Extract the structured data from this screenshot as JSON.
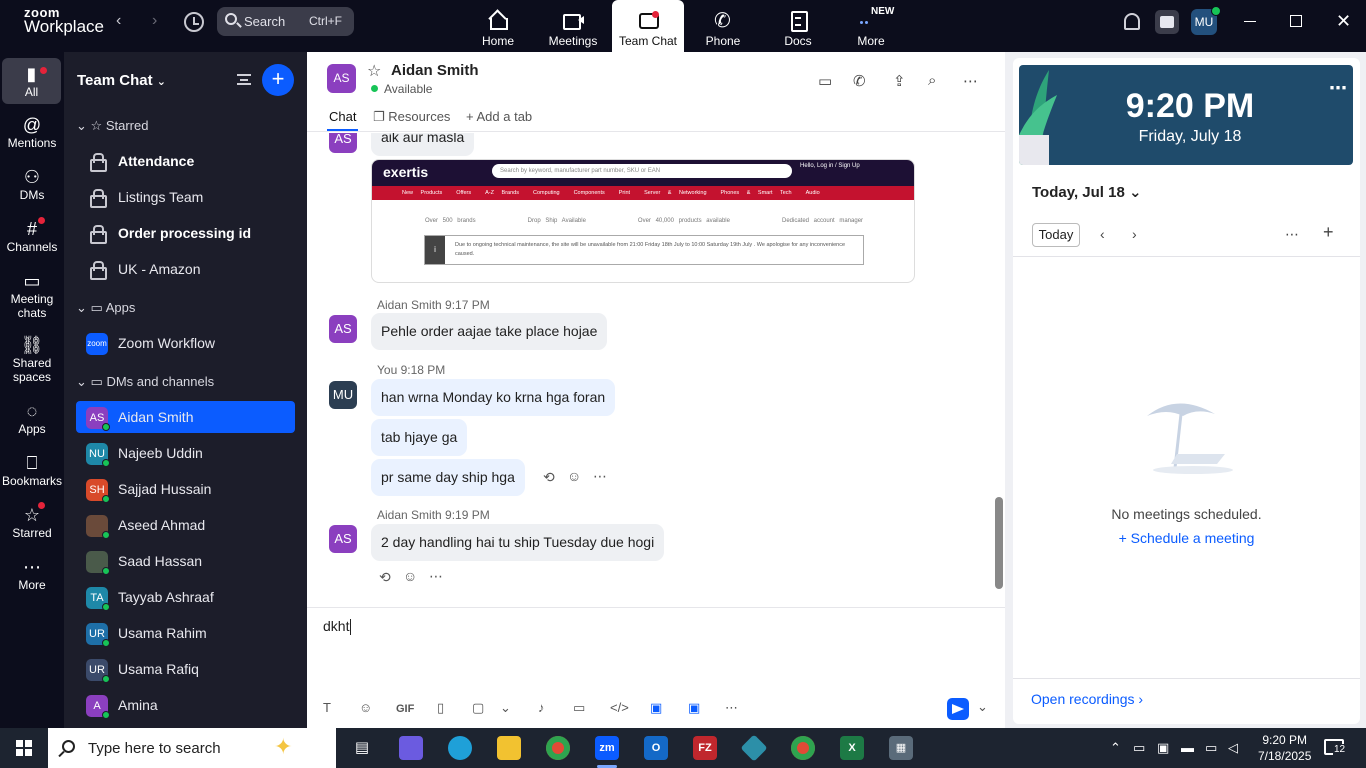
{
  "topbar": {
    "logo_top": "zoom",
    "logo_bottom": "Workplace",
    "search_label": "Search",
    "search_shortcut": "Ctrl+F",
    "tabs": [
      {
        "label": "Home",
        "icon": "home-icon"
      },
      {
        "label": "Meetings",
        "icon": "video-camera-icon"
      },
      {
        "label": "Team Chat",
        "icon": "chat-icon"
      },
      {
        "label": "Phone",
        "icon": "phone-icon"
      },
      {
        "label": "Docs",
        "icon": "document-icon"
      },
      {
        "label": "More",
        "icon": "more-dots-icon"
      }
    ],
    "new_badge": "NEW",
    "user_initials": "MU"
  },
  "leftnav": [
    {
      "label": "All",
      "icon": "chat-bubble-icon"
    },
    {
      "label": "Mentions",
      "icon": "at-icon"
    },
    {
      "label": "DMs",
      "icon": "people-icon"
    },
    {
      "label": "Channels",
      "icon": "hash-icon"
    },
    {
      "label": "Meeting chats",
      "icon": "calendar-chat-icon"
    },
    {
      "label": "Shared spaces",
      "icon": "shared-spaces-icon"
    },
    {
      "label": "Apps",
      "icon": "apps-icon"
    },
    {
      "label": "Bookmarks",
      "icon": "bookmark-icon"
    },
    {
      "label": "Starred",
      "icon": "star-icon"
    },
    {
      "label": "More",
      "icon": "more-dots-icon"
    }
  ],
  "panel": {
    "title": "Team Chat",
    "sections": {
      "starred": "Starred",
      "apps": "Apps",
      "dms": "DMs and channels"
    },
    "starred_items": [
      "Attendance",
      "Listings Team",
      "Order processing id",
      "UK - Amazon"
    ],
    "apps_items": [
      {
        "name": "Zoom Workflow",
        "badge": "zoom"
      }
    ],
    "dm_items": [
      {
        "initials": "AS",
        "name": "Aidan Smith",
        "color": "#8b3fbf"
      },
      {
        "initials": "NU",
        "name": "Najeeb Uddin",
        "color": "#1e88a8"
      },
      {
        "initials": "SH",
        "name": "Sajjad Hussain",
        "color": "#d84a2a"
      },
      {
        "initials": "",
        "name": "Aseed Ahmad",
        "color": "#6a4a3a"
      },
      {
        "initials": "",
        "name": "Saad Hassan",
        "color": "#4a5a4a"
      },
      {
        "initials": "TA",
        "name": "Tayyab Ashraaf",
        "color": "#1e88a8"
      },
      {
        "initials": "UR",
        "name": "Usama Rahim",
        "color": "#1e6fa8"
      },
      {
        "initials": "UR",
        "name": "Usama Rafiq",
        "color": "#3b4a6a"
      },
      {
        "initials": "A",
        "name": "Amina",
        "color": "#8b3fbf"
      }
    ]
  },
  "chat": {
    "contact_initials": "AS",
    "contact_name": "Aidan Smith",
    "contact_status": "Available",
    "subtabs": [
      "Chat",
      "Resources",
      "Add a tab"
    ],
    "first_message": "aik aur masla",
    "screenshot": {
      "logo": "exertis",
      "search": "Search by keyword, manufacturer part number, SKU or EAN",
      "account": "Hello, Log in / Sign Up",
      "nav": [
        "New Products",
        "Offers",
        "A-Z Brands",
        "Computing",
        "Components",
        "Print",
        "Server & Networking",
        "Phones & Smart Tech",
        "Audio Visual",
        "Gaming",
        "Software"
      ],
      "usps": [
        "Over 500 brands",
        "Drop Ship Available",
        "Over 40,000 products available",
        "Dedicated account manager"
      ],
      "notice": "Due to ongoing technical maintenance, the site will be unavailable from 21:00 Friday 18th July to 10:00 Saturday 19th July . We apologise for any inconvenience caused."
    },
    "groups": [
      {
        "author": "Aidan Smith",
        "time": "9:17 PM",
        "initials": "AS",
        "messages": [
          "Pehle order aajae take place hojae"
        ]
      },
      {
        "author": "You",
        "time": "9:18 PM",
        "initials": "MU",
        "messages": [
          "han wrna Monday ko krna hga foran",
          "tab hjaye ga",
          "pr same day ship hga"
        ]
      },
      {
        "author": "Aidan Smith",
        "time": "9:19 PM",
        "initials": "AS",
        "messages": [
          "2 day handling hai tu ship Tuesday due hogi"
        ]
      }
    ],
    "composer_text": "dkht",
    "composer_gif": "GIF"
  },
  "calendar": {
    "time": "9:20 PM",
    "date": "Friday, July 18",
    "day_label": "Today, Jul 18",
    "today_button": "Today",
    "empty": "No meetings scheduled.",
    "schedule": "Schedule a meeting",
    "open_recordings": "Open recordings"
  },
  "taskbar": {
    "search": "Type here to search",
    "time": "9:20 PM",
    "date": "7/18/2025",
    "notifications": "12"
  }
}
